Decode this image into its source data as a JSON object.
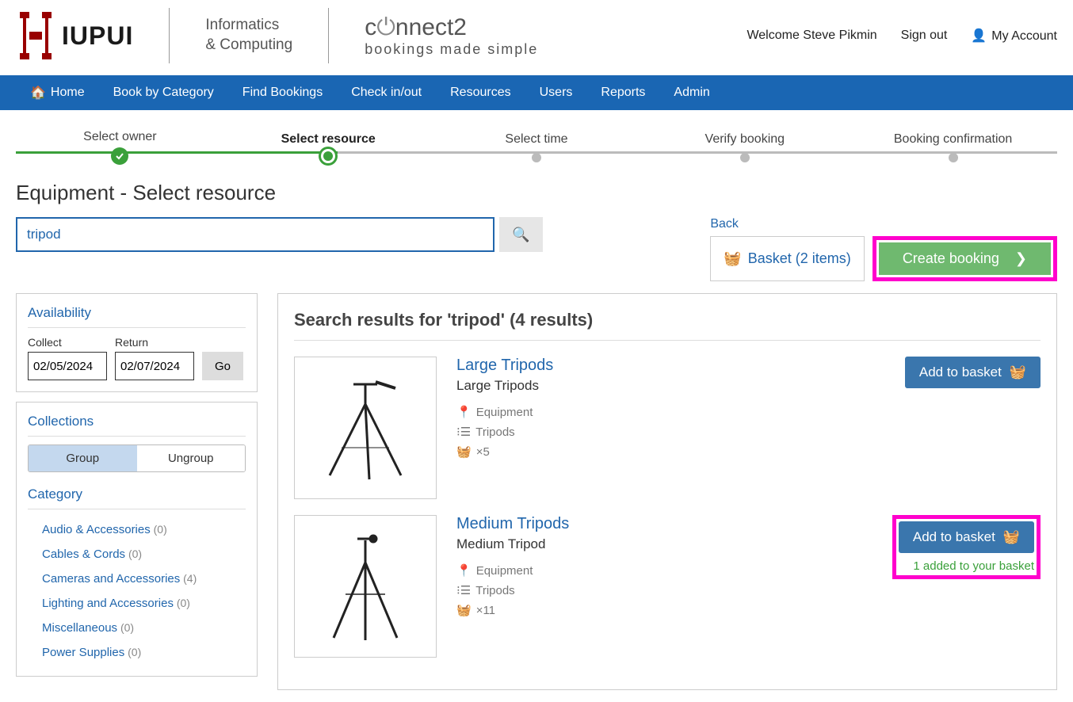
{
  "header": {
    "brand": "IUPUI",
    "dept_line1": "Informatics",
    "dept_line2": "& Computing",
    "app_name": "connect2",
    "app_tag": "bookings made simple",
    "welcome": "Welcome Steve Pikmin",
    "signout": "Sign out",
    "account": "My Account"
  },
  "nav": {
    "home": "Home",
    "book": "Book by Category",
    "find": "Find Bookings",
    "check": "Check in/out",
    "resources": "Resources",
    "users": "Users",
    "reports": "Reports",
    "admin": "Admin"
  },
  "steps": {
    "s1": "Select owner",
    "s2": "Select resource",
    "s3": "Select time",
    "s4": "Verify booking",
    "s5": "Booking confirmation"
  },
  "page_title": "Equipment - Select resource",
  "search": {
    "value": "tripod"
  },
  "actions": {
    "back": "Back",
    "basket": "Basket (2 items)",
    "create": "Create booking"
  },
  "availability": {
    "title": "Availability",
    "collect_label": "Collect",
    "collect_value": "02/05/2024",
    "return_label": "Return",
    "return_value": "02/07/2024",
    "go": "Go"
  },
  "collections": {
    "title": "Collections",
    "group": "Group",
    "ungroup": "Ungroup"
  },
  "categories": {
    "title": "Category",
    "items": [
      {
        "name": "Audio & Accessories",
        "count": "(0)"
      },
      {
        "name": "Cables & Cords",
        "count": "(0)"
      },
      {
        "name": "Cameras and Accessories",
        "count": "(4)"
      },
      {
        "name": "Lighting and Accessories",
        "count": "(0)"
      },
      {
        "name": "Miscellaneous",
        "count": "(0)"
      },
      {
        "name": "Power Supplies",
        "count": "(0)"
      }
    ]
  },
  "results": {
    "title": "Search results for 'tripod' (4 results)",
    "add_label": "Add to basket",
    "added_msg": "1 added to your basket",
    "items": [
      {
        "name": "Large Tripods",
        "sub": "Large Tripods",
        "loc": "Equipment",
        "cat": "Tripods",
        "qty": "×5"
      },
      {
        "name": "Medium Tripods",
        "sub": "Medium Tripod",
        "loc": "Equipment",
        "cat": "Tripods",
        "qty": "×11"
      }
    ]
  }
}
